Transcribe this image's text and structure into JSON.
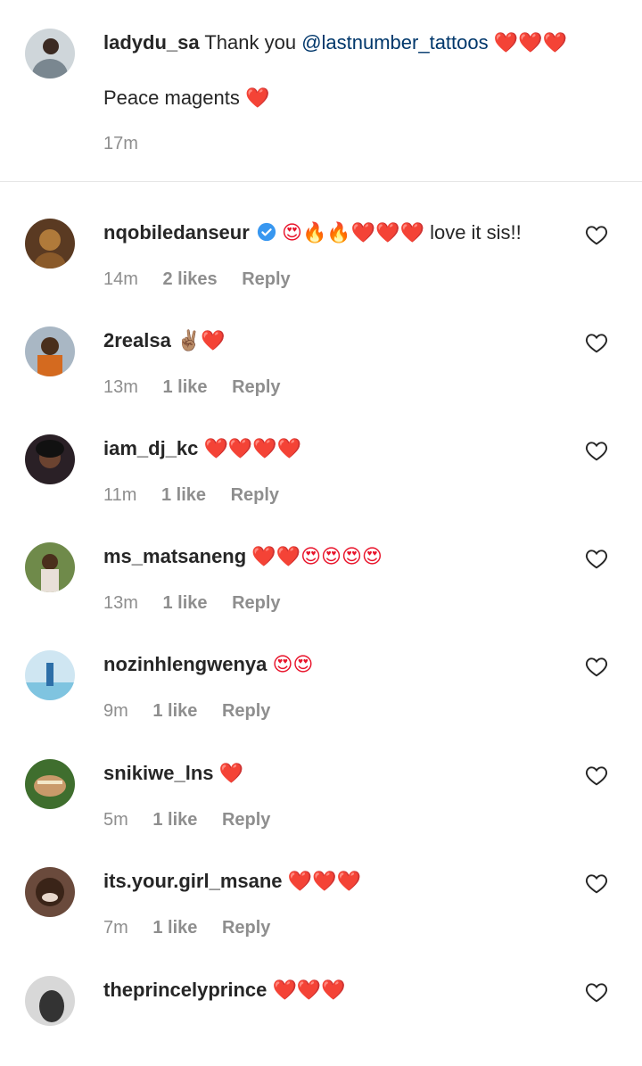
{
  "caption": {
    "username": "ladydu_sa",
    "text_prefix": "Thank you",
    "mention": "@lastnumber_tattoos",
    "emoji": "❤️❤️❤️",
    "second_line_text": "Peace magents",
    "second_line_emoji": "❤️",
    "time": "17m"
  },
  "comments": [
    {
      "username": "nqobiledanseur",
      "verified": true,
      "emoji": "😍🔥🔥❤️❤️❤️",
      "text": "love it sis!!",
      "time": "14m",
      "likes": "2 likes",
      "reply": "Reply"
    },
    {
      "username": "2realsa",
      "emoji": "✌🏽❤️",
      "text": "",
      "time": "13m",
      "likes": "1 like",
      "reply": "Reply"
    },
    {
      "username": "iam_dj_kc",
      "emoji": "❤️❤️❤️❤️",
      "text": "",
      "time": "11m",
      "likes": "1 like",
      "reply": "Reply"
    },
    {
      "username": "ms_matsaneng",
      "emoji": "❤️❤️😍😍😍😍",
      "text": "",
      "time": "13m",
      "likes": "1 like",
      "reply": "Reply"
    },
    {
      "username": "nozinhlengwenya",
      "emoji": "😍😍",
      "text": "",
      "time": "9m",
      "likes": "1 like",
      "reply": "Reply"
    },
    {
      "username": "snikiwe_lns",
      "emoji": "❤️",
      "text": "",
      "time": "5m",
      "likes": "1 like",
      "reply": "Reply"
    },
    {
      "username": "its.your.girl_msane",
      "emoji": "❤️❤️❤️",
      "text": "",
      "time": "7m",
      "likes": "1 like",
      "reply": "Reply"
    },
    {
      "username": "theprincelyprince",
      "emoji": "❤️❤️❤️",
      "text": "",
      "time": "",
      "likes": "",
      "reply": ""
    }
  ],
  "colors": {
    "link": "#00376b",
    "muted": "#8e8e8e",
    "verified": "#3897f0"
  },
  "icons": {
    "like": "heart-outline-icon",
    "verified": "verified-badge-icon"
  }
}
